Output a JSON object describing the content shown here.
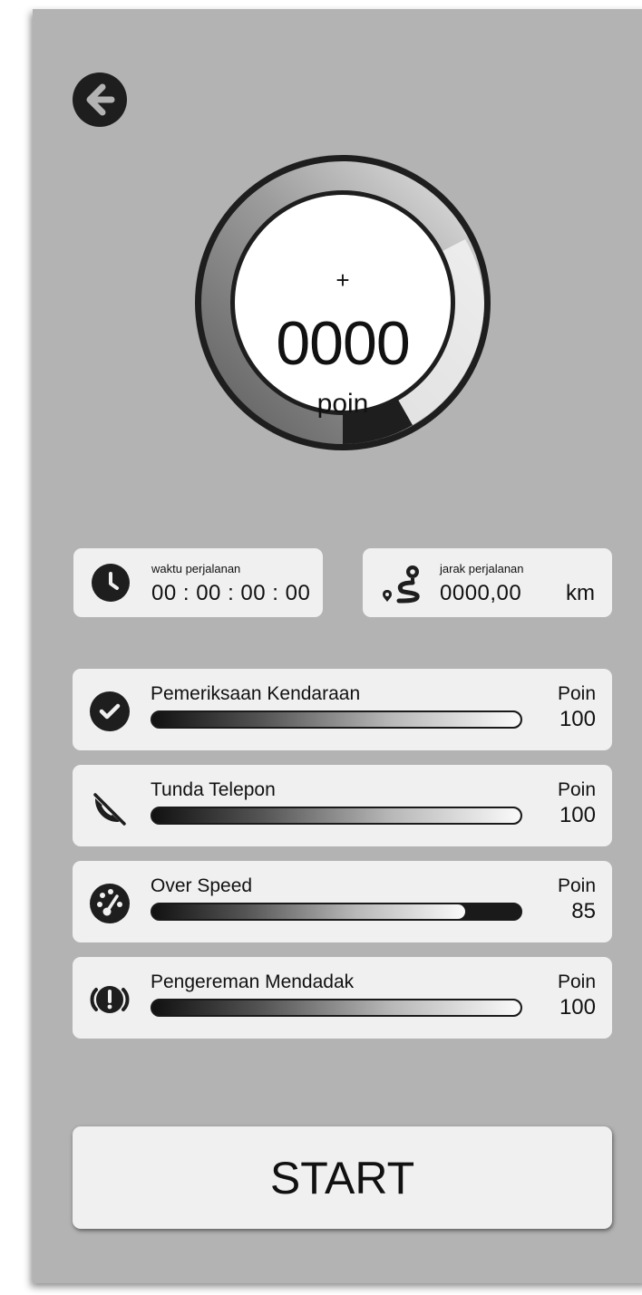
{
  "score": {
    "prefix": "+",
    "value": "0000",
    "unit": "poin"
  },
  "stats": {
    "time": {
      "label": "waktu perjalanan",
      "value": "00 : 00 : 00 : 00",
      "icon": "clock-icon"
    },
    "distance": {
      "label": "jarak perjalanan",
      "value": "0000,00",
      "unit": "km",
      "icon": "route-icon"
    }
  },
  "metrics": [
    {
      "title": "Pemeriksaan Kendaraan",
      "points_label": "Poin",
      "points": "100",
      "fill_percent": 100,
      "icon": "check-circle-icon"
    },
    {
      "title": "Tunda Telepon",
      "points_label": "Poin",
      "points": "100",
      "fill_percent": 100,
      "icon": "phone-off-icon"
    },
    {
      "title": "Over Speed",
      "points_label": "Poin",
      "points": "85",
      "fill_percent": 85,
      "icon": "speedometer-icon"
    },
    {
      "title": "Pengereman Mendadak",
      "points_label": "Poin",
      "points": "100",
      "fill_percent": 100,
      "icon": "brake-warning-icon"
    }
  ],
  "start_label": "START",
  "colors": {
    "background": "#b3b3b3",
    "card": "#f0f0f0",
    "dark": "#1e1e1e"
  }
}
